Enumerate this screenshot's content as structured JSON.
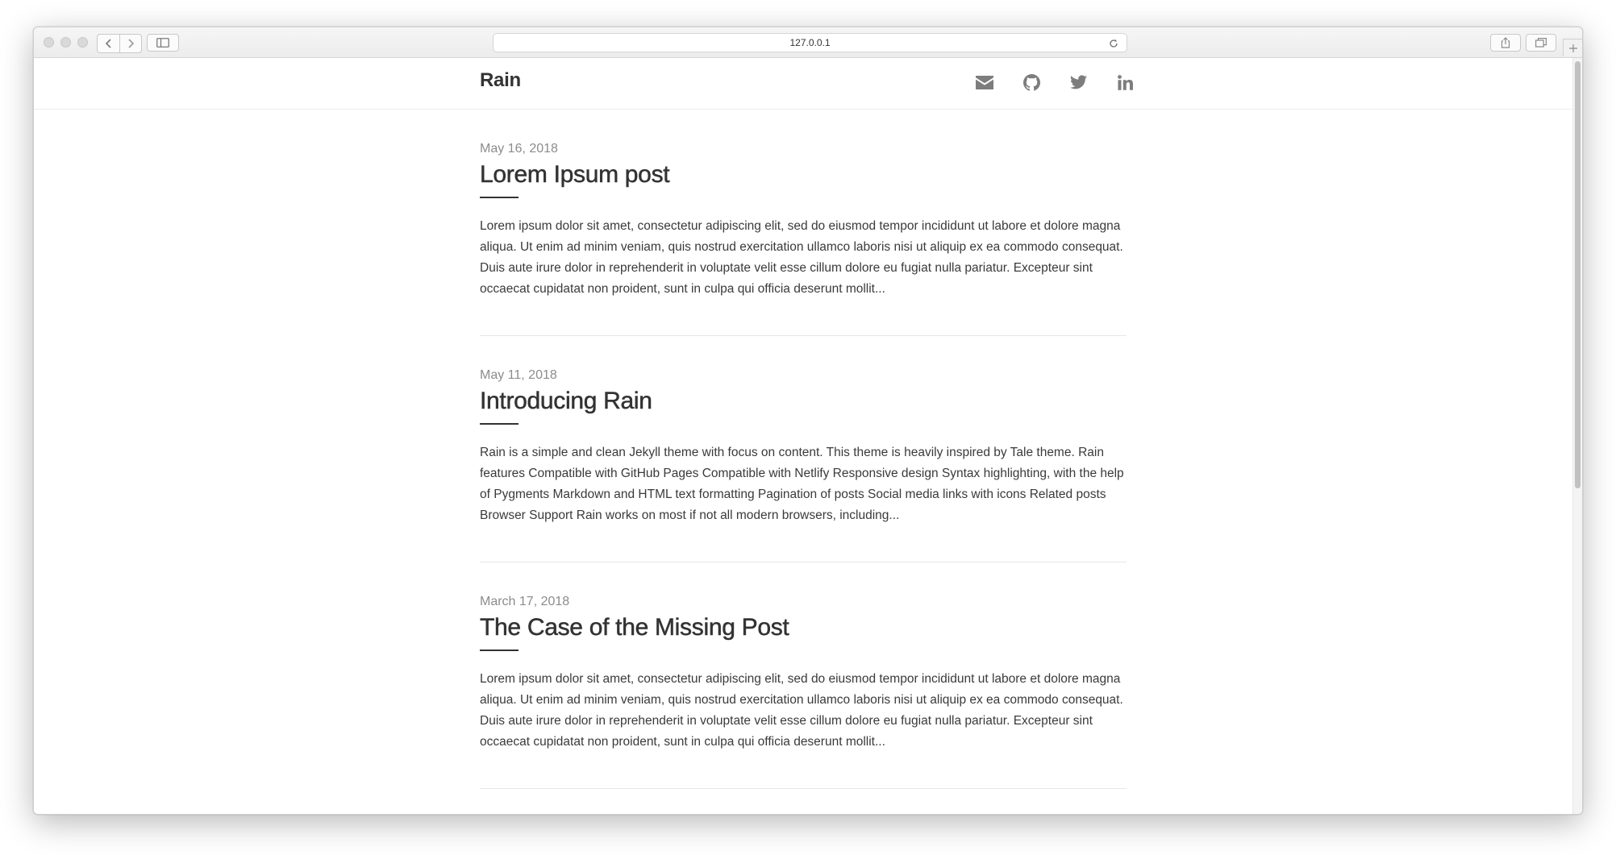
{
  "browser": {
    "url": "127.0.0.1"
  },
  "site": {
    "brand": "Rain",
    "social": [
      {
        "icon": "envelope-icon"
      },
      {
        "icon": "github-icon"
      },
      {
        "icon": "twitter-icon"
      },
      {
        "icon": "linkedin-icon"
      }
    ],
    "icon_color": "#7d7d7d"
  },
  "posts": [
    {
      "date": "May 16, 2018",
      "title": "Lorem Ipsum post",
      "excerpt": "Lorem ipsum dolor sit amet, consectetur adipiscing elit, sed do eiusmod tempor incididunt ut labore et dolore magna aliqua. Ut enim ad minim veniam, quis nostrud exercitation ullamco laboris nisi ut aliquip ex ea commodo consequat. Duis aute irure dolor in reprehenderit in voluptate velit esse cillum dolore eu fugiat nulla pariatur. Excepteur sint occaecat cupidatat non proident, sunt in culpa qui officia deserunt mollit..."
    },
    {
      "date": "May 11, 2018",
      "title": "Introducing Rain",
      "excerpt": "Rain is a simple and clean Jekyll theme with focus on content. This theme is heavily inspired by Tale theme. Rain features Compatible with GitHub Pages Compatible with Netlify Responsive design Syntax highlighting, with the help of Pygments Markdown and HTML text formatting Pagination of posts Social media links with icons Related posts Browser Support Rain works on most if not all modern browsers, including..."
    },
    {
      "date": "March 17, 2018",
      "title": "The Case of the Missing Post",
      "excerpt": "Lorem ipsum dolor sit amet, consectetur adipiscing elit, sed do eiusmod tempor incididunt ut labore et dolore magna aliqua. Ut enim ad minim veniam, quis nostrud exercitation ullamco laboris nisi ut aliquip ex ea commodo consequat. Duis aute irure dolor in reprehenderit in voluptate velit esse cillum dolore eu fugiat nulla pariatur. Excepteur sint occaecat cupidatat non proident, sunt in culpa qui officia deserunt mollit..."
    }
  ]
}
